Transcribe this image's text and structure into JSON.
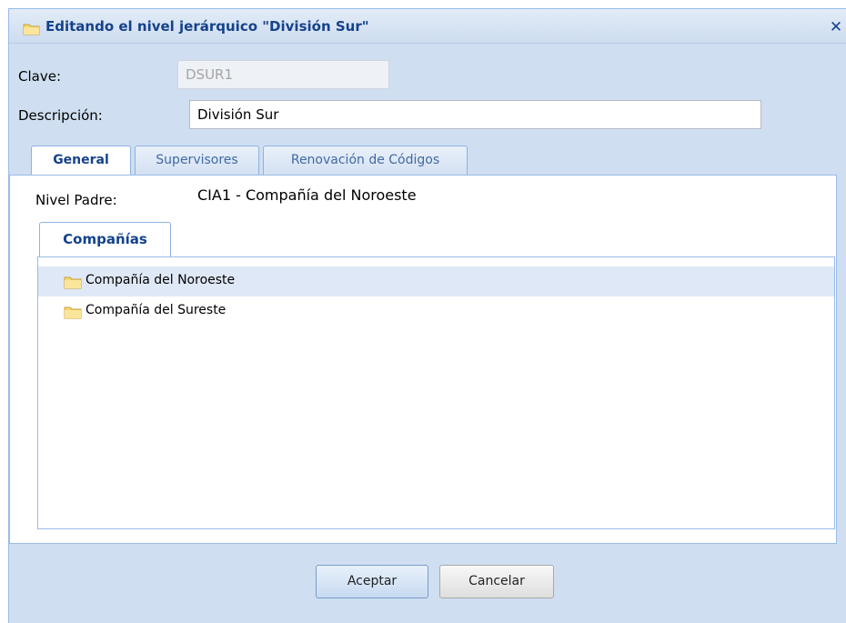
{
  "dialog": {
    "title": "Editando el nivel jerárquico \"División Sur\"",
    "close_label": "✕"
  },
  "form": {
    "clave_label": "Clave:",
    "clave_value": "DSUR1",
    "descripcion_label": "Descripción:",
    "descripcion_value": "División Sur"
  },
  "tabs": [
    {
      "label": "General",
      "active": true
    },
    {
      "label": "Supervisores",
      "active": false
    },
    {
      "label": "Renovación de Códigos",
      "active": false
    }
  ],
  "general": {
    "nivel_padre_label": "Nivel Padre:",
    "nivel_padre_value": "CIA1 - Compañía del Noroeste",
    "subtab_label": "Compañías",
    "tree_items": [
      {
        "label": "Compañía del Noroeste",
        "selected": true
      },
      {
        "label": "Compañía del Sureste",
        "selected": false
      }
    ]
  },
  "buttons": {
    "accept_label": "Aceptar",
    "cancel_label": "Cancelar"
  },
  "colors": {
    "title_text": "#15428b",
    "window_bg": "#cfdff1",
    "border": "#99bbe8",
    "selected_row": "#dfe8f6",
    "folder_yellow": "#f5d76e"
  }
}
